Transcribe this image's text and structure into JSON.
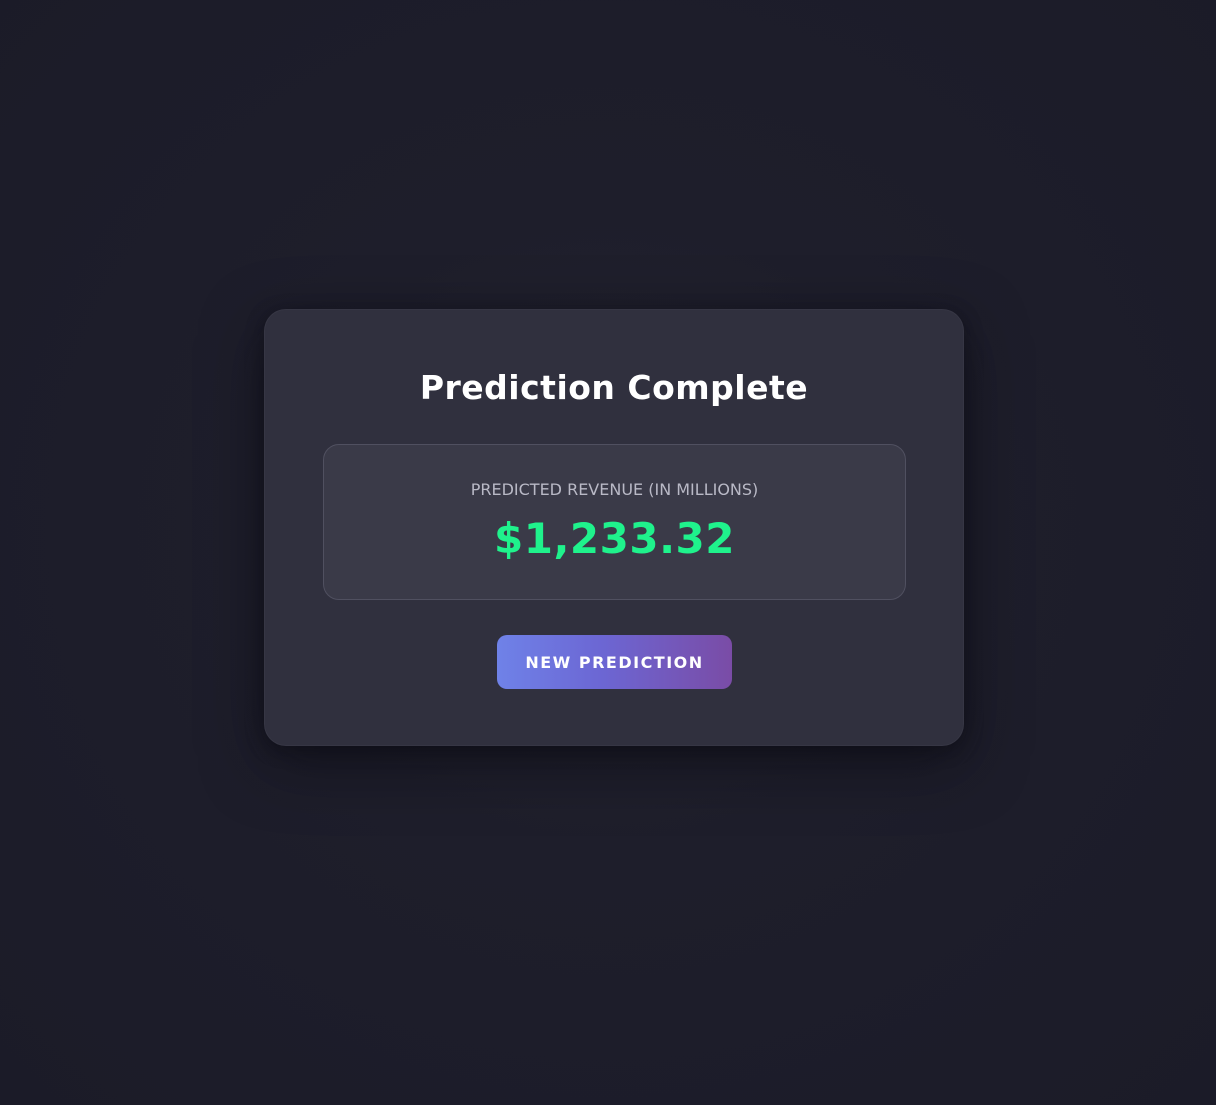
{
  "card": {
    "title": "Prediction Complete",
    "result": {
      "label": "PREDICTED REVENUE (IN MILLIONS)",
      "value": "$1,233.32"
    },
    "button_label": "NEW PREDICTION"
  },
  "colors": {
    "background": "#1e1e2b",
    "card": "#30303e",
    "result_box": "#3a3a48",
    "value_accent": "#1ff28c",
    "button_gradient_start": "#6f82e8",
    "button_gradient_end": "#7a4ca6"
  }
}
